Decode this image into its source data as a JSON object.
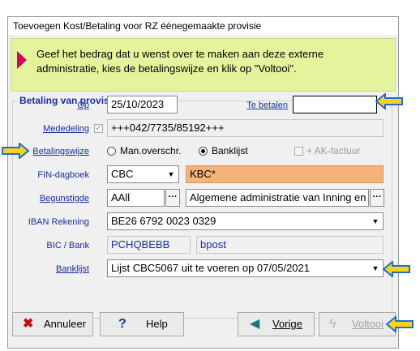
{
  "window": {
    "title": "Toevoegen Kost/Betaling voor RZ éénegemaakte provisie"
  },
  "info": {
    "message": "Geef het bedrag dat u wenst over te maken aan deze externe administratie, kies de betalingswijze en klik op \"Voltooi\"."
  },
  "group": {
    "title": "Betaling van provisie"
  },
  "fields": {
    "op_label": "Op",
    "op_value": "25/10/2023",
    "te_betalen_label": "Te betalen",
    "te_betalen_value": "",
    "mededeling_label": "Mededeling",
    "mededeling_value": "+++042/7735/85192+++",
    "betalingswijze_label": "Betalingswijze",
    "radio_man": "Man.overschr.",
    "radio_bank": "Banklijst",
    "ak_factuur": "+ AK-factuur",
    "fin_label": "FIN-dagboek",
    "fin_value": "CBC",
    "fin_desc": "KBC*",
    "begunstigde_label": "Begunstigde",
    "begunstigde_code": "AAll",
    "begunstigde_name": "Algemene administratie van Inning en inv",
    "iban_label": "IBAN Rekening",
    "iban_value": "BE26 6792 0023 0329",
    "bic_label": "BIC / Bank",
    "bic_value": "PCHQBEBB",
    "bank_value": "bpost",
    "banklijst_label": "Banklijst",
    "banklijst_value": "Lijst CBC5067 uit te voeren op 07/05/2021"
  },
  "buttons": {
    "annuleer": "Annuleer",
    "help": "Help",
    "vorige": "Vorige",
    "voltooi": "Voltooi"
  },
  "colors": {
    "accent": "#1a2e9c",
    "info_bg": "#e4f49c",
    "highlight": "#f5b37a",
    "arrow": "#ffd21a"
  },
  "icons": {
    "info": "pink-arrow-icon",
    "cancel": "x-icon",
    "help": "question-icon",
    "back": "triangle-left-icon",
    "finish": "lightning-icon",
    "pointer": "yellow-arrow-icon"
  }
}
